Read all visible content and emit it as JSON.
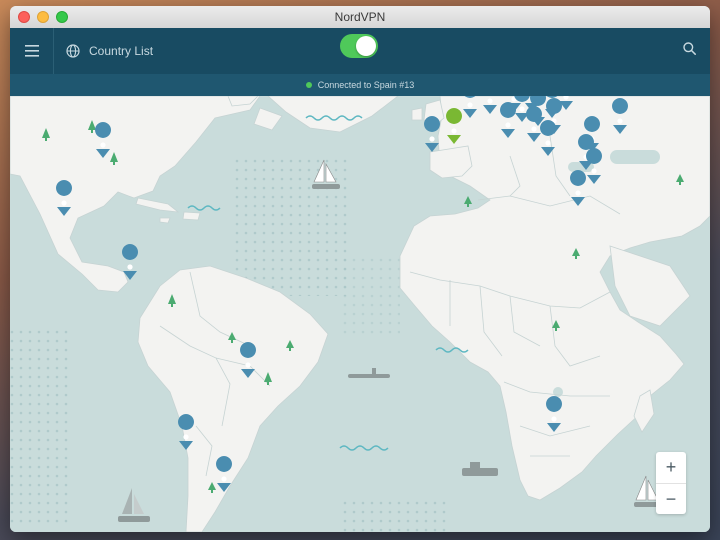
{
  "window": {
    "title": "NordVPN"
  },
  "header": {
    "menu_icon": "hamburger-icon",
    "country_list_icon": "globe-icon",
    "country_list_label": "Country List",
    "search_icon": "search-icon"
  },
  "status": {
    "text": "Connected to Spain #13",
    "dot_color": "#4fc95a"
  },
  "colors": {
    "accent": "#4fc95a",
    "header": "#184b62",
    "pin": "#4a8db0",
    "active_pin": "#7ab833",
    "land": "#f3f3f1",
    "water": "#c9dcdb"
  },
  "zoom": {
    "in_label": "+",
    "out_label": "−"
  }
}
